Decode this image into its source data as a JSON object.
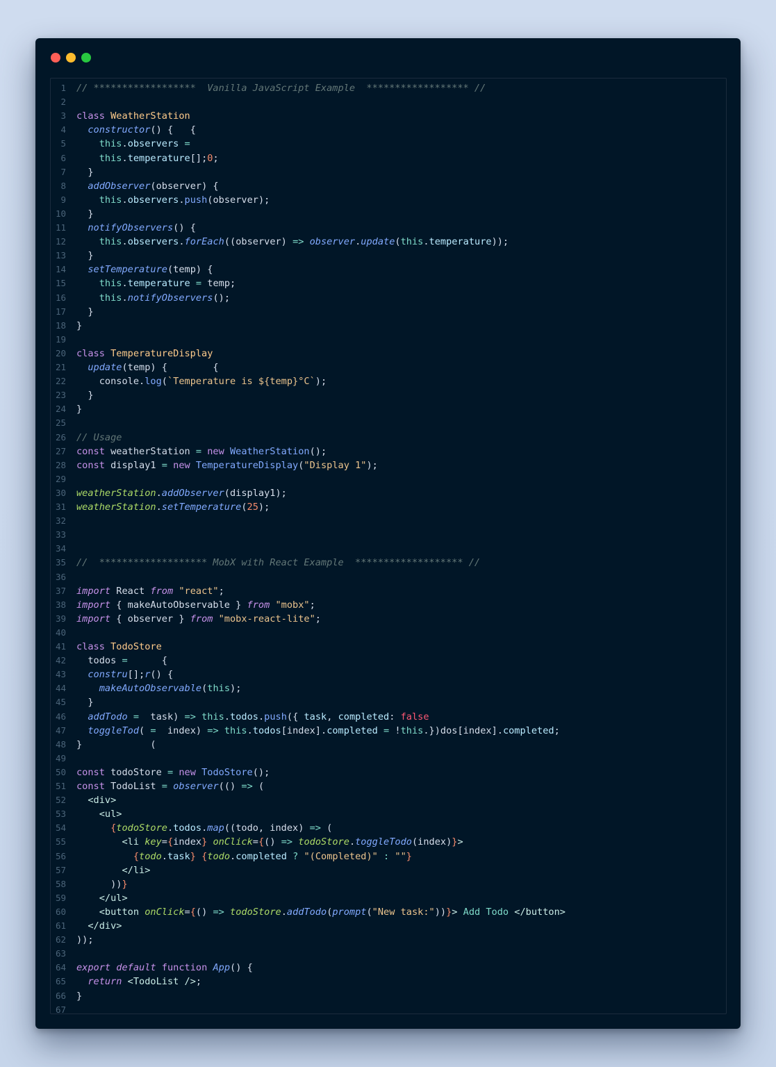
{
  "window": {
    "controls": [
      "close",
      "minimize",
      "maximize"
    ],
    "colors": {
      "close": "#ff5f57",
      "minimize": "#febc2e",
      "maximize": "#28c840",
      "background": "#011627"
    }
  },
  "editor": {
    "lines": [
      [
        [
          "// ******************  Vanilla JavaScript Example  ****************** //",
          "cmt"
        ]
      ],
      [],
      [
        [
          "class ",
          "kw"
        ],
        [
          "WeatherStation",
          "cls"
        ]
      ],
      [
        [
          "  "
        ],
        [
          "constructor",
          "fn"
        ],
        [
          "() {   {"
        ]
      ],
      [
        [
          "    "
        ],
        [
          "this",
          "this"
        ],
        [
          "."
        ],
        [
          "observers",
          "prop"
        ],
        [
          " "
        ],
        [
          "=",
          "op"
        ]
      ],
      [
        [
          "    "
        ],
        [
          "this",
          "this"
        ],
        [
          "."
        ],
        [
          "temperature",
          "prop"
        ],
        [
          "[];"
        ],
        [
          "0",
          "num"
        ],
        [
          ";"
        ]
      ],
      [
        [
          "  }"
        ]
      ],
      [
        [
          "  "
        ],
        [
          "addObserver",
          "fn"
        ],
        [
          "(observer) {"
        ]
      ],
      [
        [
          "    "
        ],
        [
          "this",
          "this"
        ],
        [
          "."
        ],
        [
          "observers",
          "prop"
        ],
        [
          "."
        ],
        [
          "push",
          "fnp"
        ],
        [
          "(observer);"
        ]
      ],
      [
        [
          "  }"
        ]
      ],
      [
        [
          "  "
        ],
        [
          "notifyObservers",
          "fn"
        ],
        [
          "() {"
        ]
      ],
      [
        [
          "    "
        ],
        [
          "this",
          "this"
        ],
        [
          "."
        ],
        [
          "observers",
          "prop"
        ],
        [
          "."
        ],
        [
          "forEach",
          "fn"
        ],
        [
          "((observer) "
        ],
        [
          "=>",
          "op"
        ],
        [
          " "
        ],
        [
          "observer",
          "fn"
        ],
        [
          "."
        ],
        [
          "update",
          "fn"
        ],
        [
          "("
        ],
        [
          "this",
          "this"
        ],
        [
          "."
        ],
        [
          "temperature",
          "prop"
        ],
        [
          "));"
        ]
      ],
      [
        [
          "  }"
        ]
      ],
      [
        [
          "  "
        ],
        [
          "setTemperature",
          "fn"
        ],
        [
          "(temp) {"
        ]
      ],
      [
        [
          "    "
        ],
        [
          "this",
          "this"
        ],
        [
          "."
        ],
        [
          "temperature",
          "prop"
        ],
        [
          " "
        ],
        [
          "=",
          "op"
        ],
        [
          " temp;"
        ]
      ],
      [
        [
          "    "
        ],
        [
          "this",
          "this"
        ],
        [
          "."
        ],
        [
          "notifyObservers",
          "fn"
        ],
        [
          "();"
        ]
      ],
      [
        [
          "  }"
        ]
      ],
      [
        [
          "}"
        ]
      ],
      [],
      [
        [
          "class ",
          "kw"
        ],
        [
          "TemperatureDisplay",
          "cls"
        ]
      ],
      [
        [
          "  "
        ],
        [
          "update",
          "fn"
        ],
        [
          "(temp) {        {"
        ]
      ],
      [
        [
          "    console."
        ],
        [
          "log",
          "fnp"
        ],
        [
          "("
        ],
        [
          "`Temperature is ${temp}°C`",
          "str"
        ],
        [
          ");"
        ]
      ],
      [
        [
          "  }"
        ]
      ],
      [
        [
          "}"
        ]
      ],
      [],
      [
        [
          "// Usage",
          "cmt"
        ]
      ],
      [
        [
          "const ",
          "kw"
        ],
        [
          "weatherStation "
        ],
        [
          "=",
          "op"
        ],
        [
          " "
        ],
        [
          "new ",
          "kw"
        ],
        [
          "WeatherStation",
          "fnp"
        ],
        [
          "();"
        ]
      ],
      [
        [
          "const ",
          "kw"
        ],
        [
          "display1 "
        ],
        [
          "=",
          "op"
        ],
        [
          " "
        ],
        [
          "new ",
          "kw"
        ],
        [
          "TemperatureDisplay",
          "fnp"
        ],
        [
          "("
        ],
        [
          "\"Display 1\"",
          "str"
        ],
        [
          ");"
        ]
      ],
      [],
      [
        [
          "weatherStation",
          "vari"
        ],
        [
          "."
        ],
        [
          "addObserver",
          "fn"
        ],
        [
          "(display1);"
        ]
      ],
      [
        [
          "weatherStation",
          "vari"
        ],
        [
          "."
        ],
        [
          "setTemperature",
          "fn"
        ],
        [
          "("
        ],
        [
          "25",
          "num"
        ],
        [
          ");"
        ]
      ],
      [],
      [],
      [],
      [
        [
          "//  ******************* MobX with React Example  ******************* //",
          "cmt"
        ]
      ],
      [],
      [
        [
          "import ",
          "kwi"
        ],
        [
          "React "
        ],
        [
          "from ",
          "kwi"
        ],
        [
          "\"react\"",
          "str"
        ],
        [
          ";"
        ]
      ],
      [
        [
          "import ",
          "kwi"
        ],
        [
          "{ makeAutoObservable } "
        ],
        [
          "from ",
          "kwi"
        ],
        [
          "\"mobx\"",
          "str"
        ],
        [
          ";"
        ]
      ],
      [
        [
          "import ",
          "kwi"
        ],
        [
          "{ observer } "
        ],
        [
          "from ",
          "kwi"
        ],
        [
          "\"mobx-react-lite\"",
          "str"
        ],
        [
          ";"
        ]
      ],
      [],
      [
        [
          "class ",
          "kw"
        ],
        [
          "TodoStore",
          "cls"
        ]
      ],
      [
        [
          "  todos "
        ],
        [
          "=",
          "op"
        ],
        [
          "      {"
        ]
      ],
      [
        [
          "  "
        ],
        [
          "constru",
          "fn"
        ],
        [
          "[];"
        ],
        [
          "r",
          "fn"
        ],
        [
          "() {"
        ]
      ],
      [
        [
          "    "
        ],
        [
          "makeAutoObservable",
          "fn"
        ],
        [
          "("
        ],
        [
          "this",
          "this"
        ],
        [
          ");"
        ]
      ],
      [
        [
          "  }"
        ]
      ],
      [
        [
          "  "
        ],
        [
          "addTodo",
          "fn"
        ],
        [
          " "
        ],
        [
          "=",
          "op"
        ],
        [
          "  task) "
        ],
        [
          "=>",
          "op"
        ],
        [
          " "
        ],
        [
          "this",
          "this"
        ],
        [
          "."
        ],
        [
          "todos",
          "prop"
        ],
        [
          "."
        ],
        [
          "push",
          "fnp"
        ],
        [
          "({ "
        ],
        [
          "task",
          "prop"
        ],
        [
          ", "
        ],
        [
          "completed",
          "prop"
        ],
        [
          ": "
        ],
        [
          "false",
          "bool"
        ]
      ],
      [
        [
          "  "
        ],
        [
          "toggleTod",
          "fn"
        ],
        [
          "( "
        ],
        [
          "=",
          "op"
        ],
        [
          "  index) "
        ],
        [
          "=>",
          "op"
        ],
        [
          " "
        ],
        [
          "this",
          "this"
        ],
        [
          "."
        ],
        [
          "todos",
          "prop"
        ],
        [
          "[index]."
        ],
        [
          "completed",
          "prop"
        ],
        [
          " "
        ],
        [
          "=",
          "op"
        ],
        [
          " !"
        ],
        [
          "this",
          "this"
        ],
        [
          ".})dos[index]."
        ],
        [
          "completed",
          "prop"
        ],
        [
          ";"
        ]
      ],
      [
        [
          "}            ("
        ]
      ],
      [],
      [
        [
          "const ",
          "kw"
        ],
        [
          "todoStore "
        ],
        [
          "=",
          "op"
        ],
        [
          " "
        ],
        [
          "new ",
          "kw"
        ],
        [
          "TodoStore",
          "fnp"
        ],
        [
          "();"
        ]
      ],
      [
        [
          "const ",
          "kw"
        ],
        [
          "TodoList "
        ],
        [
          "=",
          "op"
        ],
        [
          " "
        ],
        [
          "observer",
          "fn"
        ],
        [
          "(() "
        ],
        [
          "=>",
          "op"
        ],
        [
          " ("
        ]
      ],
      [
        [
          "  "
        ],
        [
          "<div>",
          "tag"
        ]
      ],
      [
        [
          "    "
        ],
        [
          "<ul>",
          "tag"
        ]
      ],
      [
        [
          "      "
        ],
        [
          "{",
          "brace"
        ],
        [
          "todoStore",
          "vari"
        ],
        [
          "."
        ],
        [
          "todos",
          "prop"
        ],
        [
          "."
        ],
        [
          "map",
          "fn"
        ],
        [
          "((todo, index) "
        ],
        [
          "=>",
          "op"
        ],
        [
          " ("
        ]
      ],
      [
        [
          "        "
        ],
        [
          "<li ",
          "tag"
        ],
        [
          "key",
          "attr"
        ],
        [
          "="
        ],
        [
          "{",
          "brace"
        ],
        [
          "index"
        ],
        [
          "}",
          "brace"
        ],
        [
          " "
        ],
        [
          "onClick",
          "attr"
        ],
        [
          "="
        ],
        [
          "{",
          "brace"
        ],
        [
          "() "
        ],
        [
          "=>",
          "op"
        ],
        [
          " "
        ],
        [
          "todoStore",
          "vari"
        ],
        [
          "."
        ],
        [
          "toggleTodo",
          "fn"
        ],
        [
          "(index)"
        ],
        [
          "}",
          "brace"
        ],
        [
          ">",
          "tag"
        ]
      ],
      [
        [
          "          "
        ],
        [
          "{",
          "brace"
        ],
        [
          "todo",
          "vari"
        ],
        [
          "."
        ],
        [
          "task",
          "prop"
        ],
        [
          "}",
          "brace"
        ],
        [
          " "
        ],
        [
          "{",
          "brace"
        ],
        [
          "todo",
          "vari"
        ],
        [
          "."
        ],
        [
          "completed",
          "prop"
        ],
        [
          " "
        ],
        [
          "?",
          "op"
        ],
        [
          " "
        ],
        [
          "\"(Completed)\"",
          "str"
        ],
        [
          " "
        ],
        [
          ":",
          "op"
        ],
        [
          " "
        ],
        [
          "\"\"",
          "str"
        ],
        [
          "}",
          "brace"
        ]
      ],
      [
        [
          "        "
        ],
        [
          "</li>",
          "tag"
        ]
      ],
      [
        [
          "      ))"
        ],
        [
          "}",
          "brace"
        ]
      ],
      [
        [
          "    "
        ],
        [
          "</ul>",
          "tag"
        ]
      ],
      [
        [
          "    "
        ],
        [
          "<button ",
          "tag"
        ],
        [
          "onClick",
          "attr"
        ],
        [
          "="
        ],
        [
          "{",
          "brace"
        ],
        [
          "() "
        ],
        [
          "=>",
          "op"
        ],
        [
          " "
        ],
        [
          "todoStore",
          "vari"
        ],
        [
          "."
        ],
        [
          "addTodo",
          "fn"
        ],
        [
          "("
        ],
        [
          "prompt",
          "fn"
        ],
        [
          "("
        ],
        [
          "\"New task:\"",
          "str"
        ],
        [
          "))"
        ],
        [
          "}",
          "brace"
        ],
        [
          ">",
          "tag"
        ],
        [
          " Add Todo ",
          "op"
        ],
        [
          "</button>",
          "tag"
        ]
      ],
      [
        [
          "  "
        ],
        [
          "</div>",
          "tag"
        ]
      ],
      [
        [
          "));"
        ]
      ],
      [],
      [
        [
          "export ",
          "kwi"
        ],
        [
          "default ",
          "kwi"
        ],
        [
          "function ",
          "kw"
        ],
        [
          "App",
          "fn"
        ],
        [
          "() {"
        ]
      ],
      [
        [
          "  "
        ],
        [
          "return ",
          "kwi"
        ],
        [
          "<TodoList />",
          "tag"
        ],
        [
          ";"
        ]
      ],
      [
        [
          "}"
        ]
      ],
      []
    ]
  }
}
